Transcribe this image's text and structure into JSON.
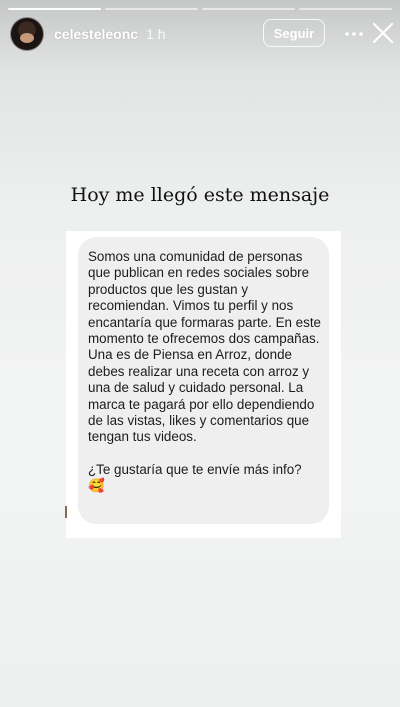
{
  "story": {
    "progress_segments": 4,
    "progress_done": 1,
    "username": "celesteleonc",
    "timestamp": "1 h",
    "follow_label": "Seguir",
    "more_icon": "more-horizontal-icon",
    "close_icon": "close-icon",
    "caption": "Hoy me llegó este mensaje"
  },
  "message": {
    "paragraph1": "Somos una comunidad de personas que publican en redes sociales sobre productos que les gustan y recomiendan. Vimos tu perfil y nos encantaría que formaras parte. En este momento te ofrecemos dos campañas. Una es de Piensa en Arroz, donde debes realizar una receta con arroz y una de salud y cuidado personal. La marca te pagará por ello dependiendo de las vistas, likes y comentarios que tengan tus videos.",
    "paragraph2": "¿Te gustaría que te envíe más info? 🥰"
  }
}
